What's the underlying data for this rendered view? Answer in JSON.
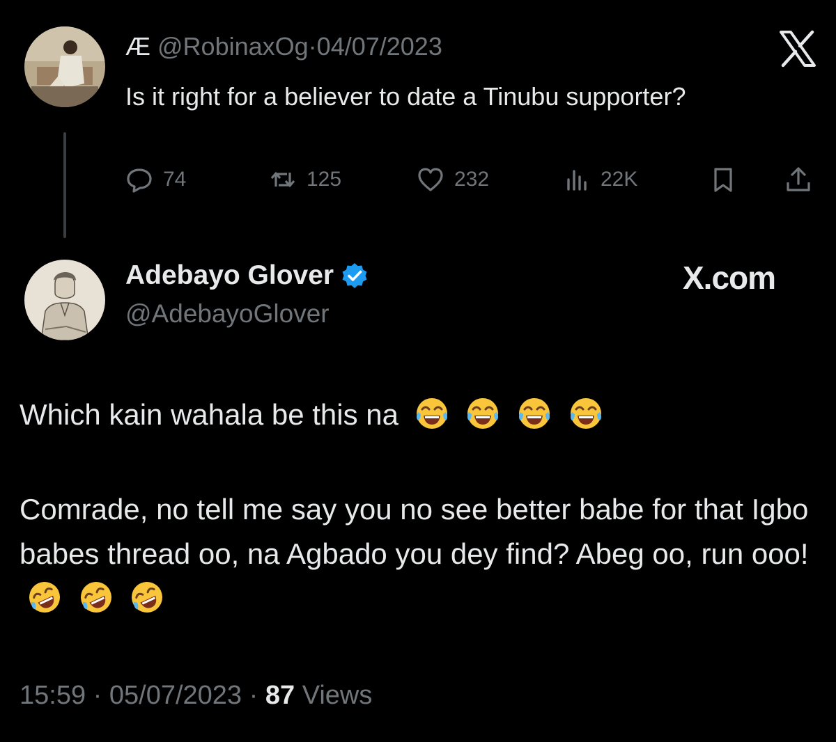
{
  "quoted_tweet": {
    "display_name": "Æ",
    "handle": "@RobinaxOg",
    "separator": "·",
    "date": "04/07/2023",
    "text": "Is it right for a believer to date a Tinubu supporter?",
    "actions": {
      "replies": "74",
      "retweets": "125",
      "likes": "232",
      "views": "22K"
    }
  },
  "reply_tweet": {
    "display_name": "Adebayo Glover",
    "handle": "@AdebayoGlover",
    "watermark": "X.com",
    "paragraph1": "Which kain wahala be this na",
    "paragraph2": "Comrade, no tell me say you no see better babe for that Igbo babes thread oo, na Agbado you dey find? Abeg oo, run ooo!",
    "time": "15:59",
    "date": "05/07/2023",
    "views_count": "87",
    "views_label": "Views"
  },
  "icons": {
    "brand": "x-logo-icon",
    "reply": "reply-icon",
    "retweet": "retweet-icon",
    "like": "heart-icon",
    "views": "views-icon",
    "bookmark": "bookmark-icon",
    "share": "share-icon",
    "verified": "verified-badge-icon",
    "emoji1": "tears-of-joy-emoji",
    "emoji2": "rofl-emoji"
  },
  "colors": {
    "background": "#000000",
    "text_primary": "#e7e9ea",
    "text_secondary": "#71767b",
    "verified": "#1d9bf0"
  }
}
